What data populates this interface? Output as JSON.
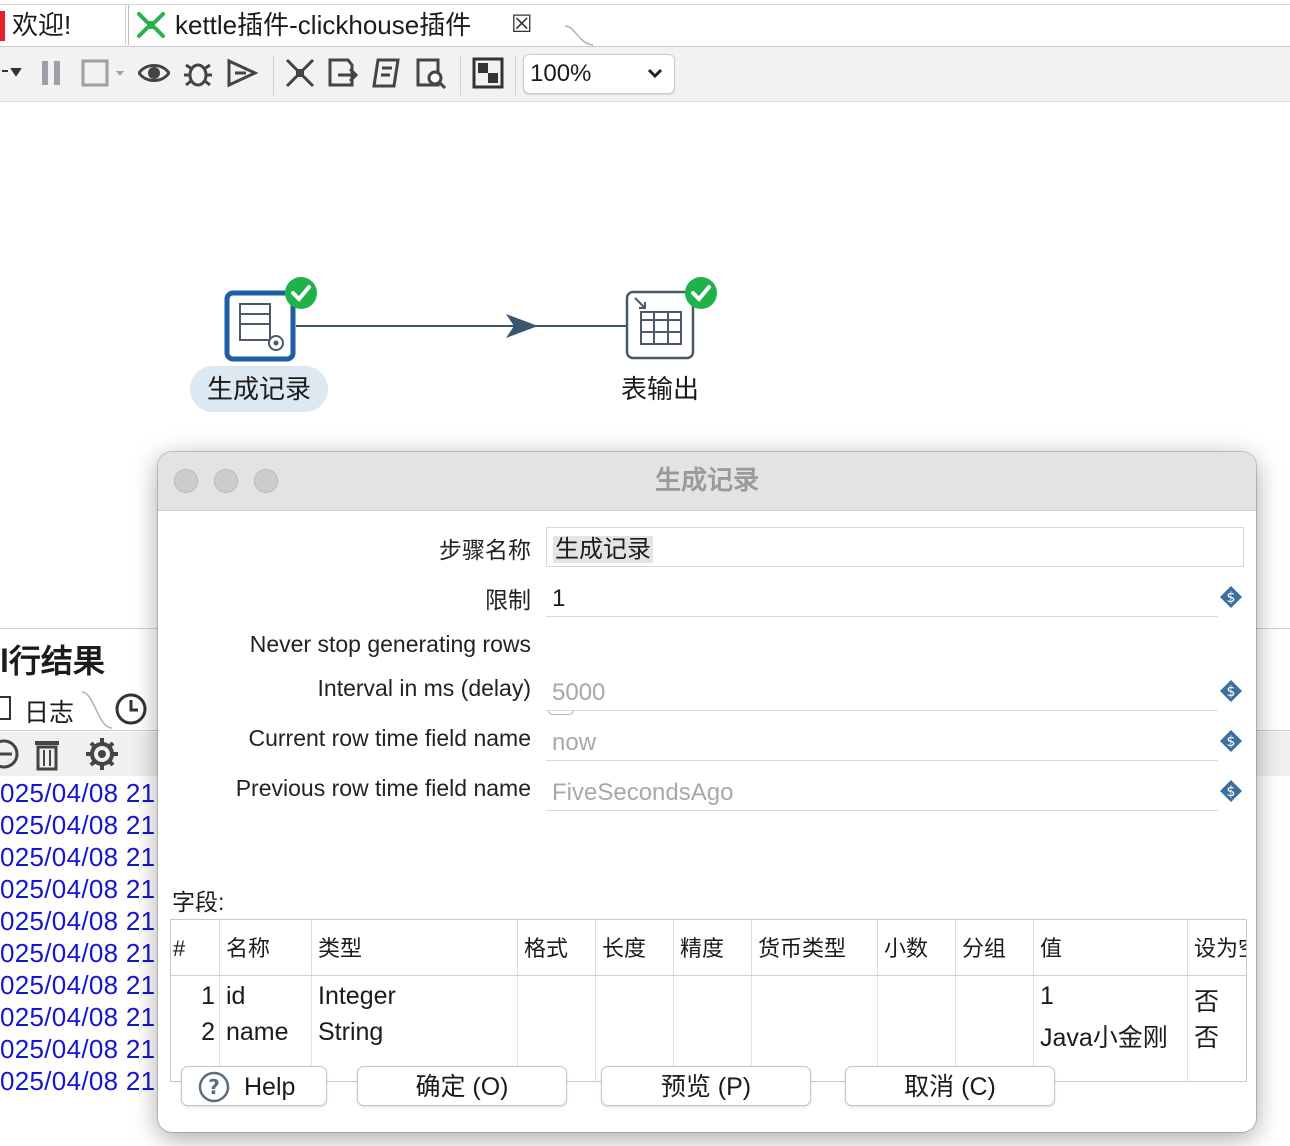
{
  "tabs": {
    "welcome": "欢迎!",
    "active": "kettle插件-clickhouse插件"
  },
  "toolbar": {
    "zoom": "100%"
  },
  "canvas": {
    "steps": [
      {
        "label": "生成记录",
        "status": "ok"
      },
      {
        "label": "表输出",
        "status": "ok"
      }
    ]
  },
  "bottom_panel": {
    "title": "执行结果",
    "title_visible": "l行结果",
    "log_tab": "日志",
    "log_lines": [
      "025/04/08 21",
      "025/04/08 21",
      "025/04/08 21",
      "025/04/08 21",
      "025/04/08 21",
      "025/04/08 21",
      "025/04/08 21",
      "025/04/08 21",
      "025/04/08 21",
      "025/04/08 21"
    ]
  },
  "dialog": {
    "title": "生成记录",
    "step_name_label": "步骤名称",
    "step_name_value": "生成记录",
    "limit_label": "限制",
    "limit_value": "1",
    "never_stop_label": "Never stop generating rows",
    "never_stop_checked": false,
    "interval_label": "Interval in ms (delay)",
    "interval_value": "5000",
    "current_time_label": "Current row time field name",
    "current_time_value": "now",
    "previous_time_label": "Previous row time field name",
    "previous_time_value": "FiveSecondsAgo",
    "fields_label": "字段:",
    "table": {
      "headers": [
        "#",
        "名称",
        "类型",
        "格式",
        "长度",
        "精度",
        "货币类型",
        "小数",
        "分组",
        "值",
        "设为空"
      ],
      "rows": [
        {
          "num": "1",
          "name": "id",
          "type": "Integer",
          "value": "1",
          "null": "否"
        },
        {
          "num": "2",
          "name": "name",
          "type": "String",
          "value": "Java小金刚",
          "null": "否"
        }
      ]
    },
    "buttons": {
      "help": "Help",
      "ok": "确定 (O)",
      "preview": "预览 (P)",
      "cancel": "取消 (C)"
    }
  },
  "colors": {
    "accent_blue": "#1d5ea6",
    "ok_green": "#1fb24a",
    "log_blue": "#1515d0",
    "hop_line": "#3a556e"
  }
}
